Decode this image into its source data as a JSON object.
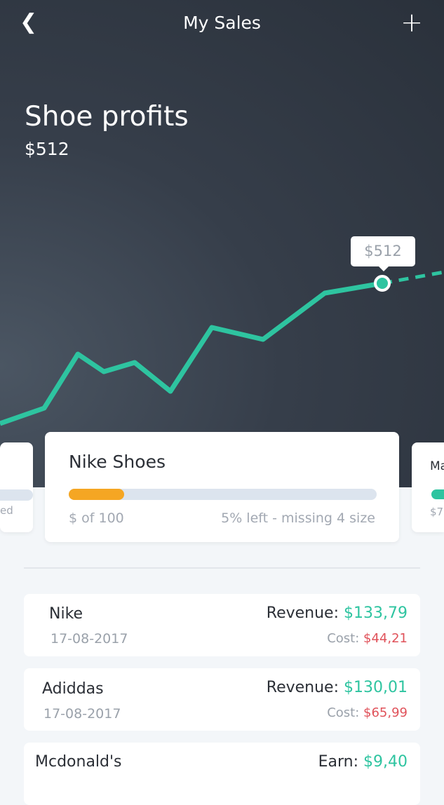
{
  "nav": {
    "back_icon": "chevron-left-icon",
    "title": "My Sales",
    "add_icon": "plus-icon"
  },
  "summary": {
    "title": "Shoe profits",
    "value": "$512"
  },
  "chart_data": {
    "type": "line",
    "title": "Shoe profits",
    "tooltip": "$512",
    "values": [
      312,
      334,
      411,
      386,
      399,
      358,
      449,
      432,
      498,
      512
    ],
    "projected": [
      512,
      528
    ],
    "colors": {
      "line": "#2ec4a0"
    }
  },
  "cards": {
    "left": {
      "label_partial": "ed"
    },
    "main": {
      "name": "Nike Shoes",
      "progress": 0.18,
      "left_label": "$ of 100",
      "right_label": "5% left - missing 4 size",
      "color": "#f5a623"
    },
    "right": {
      "name_partial": "Ma",
      "label_partial": "$7",
      "color": "#2ec4a0"
    }
  },
  "transactions": [
    {
      "name": "Nike",
      "date": "17-08-2017",
      "revenue_label": "Revenue:",
      "revenue": "$133,79",
      "cost_label": "Cost:",
      "cost": "$44,21"
    },
    {
      "name": "Adiddas",
      "date": "17-08-2017",
      "revenue_label": "Revenue:",
      "revenue": "$130,01",
      "cost_label": "Cost:",
      "cost": "$65,99"
    },
    {
      "name": "Mcdonald's",
      "revenue_label": "Earn:",
      "revenue": "$9,40"
    }
  ]
}
